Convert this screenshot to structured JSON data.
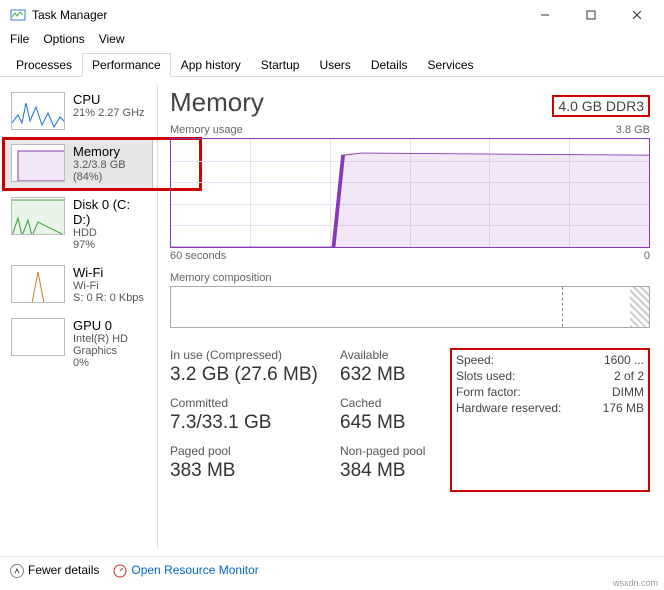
{
  "window": {
    "title": "Task Manager"
  },
  "menus": [
    "File",
    "Options",
    "View"
  ],
  "tabs": [
    "Processes",
    "Performance",
    "App history",
    "Startup",
    "Users",
    "Details",
    "Services"
  ],
  "active_tab_index": 1,
  "sidebar": {
    "items": [
      {
        "name": "CPU",
        "sub": "21% 2.27 GHz"
      },
      {
        "name": "Memory",
        "sub": "3.2/3.8 GB (84%)"
      },
      {
        "name": "Disk 0 (C: D:)",
        "sub1": "HDD",
        "sub2": "97%"
      },
      {
        "name": "Wi-Fi",
        "sub1": "Wi-Fi",
        "sub2": "S: 0 R: 0 Kbps"
      },
      {
        "name": "GPU 0",
        "sub1": "Intel(R) HD Graphics",
        "sub2": "0%"
      }
    ]
  },
  "content": {
    "title": "Memory",
    "hw_spec": "4.0 GB DDR3",
    "usage_label": "Memory usage",
    "usage_max": "3.8 GB",
    "x_left": "60 seconds",
    "x_right": "0",
    "composition_label": "Memory composition",
    "stats": {
      "in_use_label": "In use (Compressed)",
      "in_use_value": "3.2 GB (27.6 MB)",
      "available_label": "Available",
      "available_value": "632 MB",
      "committed_label": "Committed",
      "committed_value": "7.3/33.1 GB",
      "cached_label": "Cached",
      "cached_value": "645 MB",
      "paged_label": "Paged pool",
      "paged_value": "383 MB",
      "nonpaged_label": "Non-paged pool",
      "nonpaged_value": "384 MB"
    },
    "specs": {
      "speed_label": "Speed:",
      "speed_value": "1600 ...",
      "slots_label": "Slots used:",
      "slots_value": "2 of 2",
      "form_label": "Form factor:",
      "form_value": "DIMM",
      "hwres_label": "Hardware reserved:",
      "hwres_value": "176 MB"
    }
  },
  "footer": {
    "fewer": "Fewer details",
    "resmon": "Open Resource Monitor"
  },
  "branding": "wsxdn.com",
  "chart_data": {
    "type": "area",
    "title": "Memory usage",
    "xlabel": "seconds ago",
    "ylabel": "GB",
    "ylim": [
      0,
      3.8
    ],
    "xrange": [
      60,
      0
    ],
    "series": [
      {
        "name": "In use",
        "x": [
          60,
          40,
          38,
          36,
          0
        ],
        "values": [
          0,
          0,
          3.2,
          3.3,
          3.2
        ]
      }
    ]
  }
}
